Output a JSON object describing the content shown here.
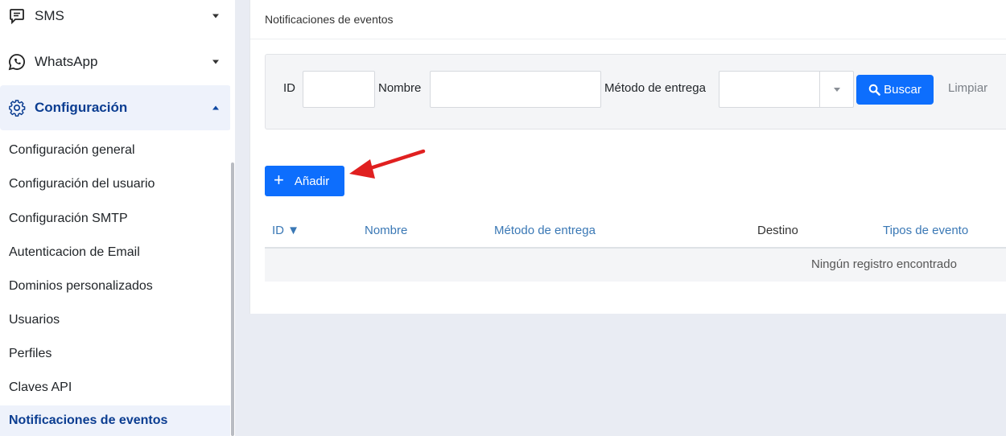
{
  "sidebar": {
    "groups": [
      {
        "label": "SMS",
        "icon": "sms-chat-icon"
      },
      {
        "label": "WhatsApp",
        "icon": "whatsapp-icon"
      },
      {
        "label": "Configuración",
        "icon": "gear-icon"
      }
    ],
    "items": [
      {
        "label": "Configuración general"
      },
      {
        "label": "Configuración del usuario"
      },
      {
        "label": "Configuración SMTP"
      },
      {
        "label": "Autenticacion de Email"
      },
      {
        "label": "Dominios personalizados"
      },
      {
        "label": "Usuarios"
      },
      {
        "label": "Perfiles"
      },
      {
        "label": "Claves API"
      },
      {
        "label": "Notificaciones de eventos"
      }
    ],
    "active_item": "Notificaciones de eventos"
  },
  "main": {
    "title": "Notificaciones de eventos",
    "filters": {
      "id_label": "ID",
      "id_value": "",
      "name_label": "Nombre",
      "name_value": "",
      "delivery_label": "Método de entrega",
      "delivery_value": "",
      "search_button": "Buscar",
      "clear_link": "Limpiar"
    },
    "add_button": "Añadir",
    "table": {
      "columns": [
        {
          "label": "ID ▼",
          "sortable": true
        },
        {
          "label": "Nombre",
          "sortable": true
        },
        {
          "label": "Método de entrega",
          "sortable": true
        },
        {
          "label": "Destino",
          "sortable": false
        },
        {
          "label": "Tipos de evento",
          "sortable": true
        }
      ],
      "empty_message": "Ningún registro encontrado"
    }
  },
  "colors": {
    "primary": "#0d6efd",
    "sidebar_active_text": "#0b3d91",
    "link_header": "#3a78b5",
    "annotation_arrow": "#e02020"
  }
}
